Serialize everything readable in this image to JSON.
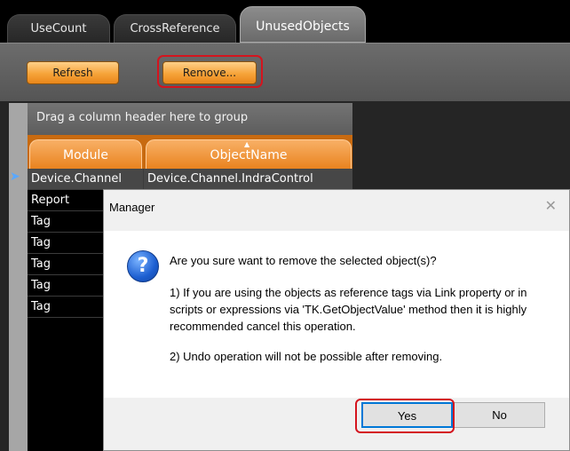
{
  "tabs": [
    {
      "label": "UseCount",
      "active": false
    },
    {
      "label": "CrossReference",
      "active": false
    },
    {
      "label": "UnusedObjects",
      "active": true
    }
  ],
  "toolbar": {
    "refresh_label": "Refresh",
    "remove_label": "Remove..."
  },
  "grid": {
    "group_hint": "Drag a column header here to group",
    "columns": [
      "Module",
      "ObjectName"
    ],
    "sorted_column": "ObjectName",
    "rows": [
      {
        "module": "Device.Channel",
        "object": "Device.Channel.IndraControl",
        "selected": true
      },
      {
        "module": "Report",
        "object": ""
      },
      {
        "module": "Tag",
        "object": ""
      },
      {
        "module": "Tag",
        "object": ""
      },
      {
        "module": "Tag",
        "object": ""
      },
      {
        "module": "Tag",
        "object": ""
      },
      {
        "module": "Tag",
        "object": ""
      }
    ]
  },
  "dialog": {
    "title": "Manager",
    "icon": "question-icon",
    "message_line1": "Are you sure want to remove the selected object(s)?",
    "message_line2": "1) If you are using the objects as reference tags via Link property or in scripts or expressions via 'TK.GetObjectValue' method then it is highly recommended cancel this operation.",
    "message_line3": "2) Undo operation will not be possible after removing.",
    "yes_label": "Yes",
    "no_label": "No"
  },
  "colors": {
    "accent_orange": "#f6a339",
    "highlight_red": "#d4141e",
    "focus_blue": "#0078d7"
  }
}
